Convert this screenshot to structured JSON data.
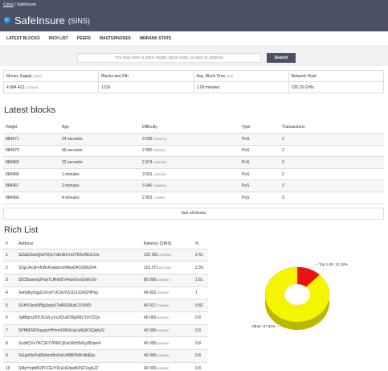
{
  "breadcrumb": {
    "root": "Coins",
    "sep": "/",
    "current": "SafeInsure"
  },
  "brand": {
    "name": "SafeInsure",
    "symbol": "(SINS)"
  },
  "nav": [
    "LATEST BLOCKS",
    "RICH LIST",
    "PEERS",
    "MASTERNODES",
    "MNRANK STATS"
  ],
  "search": {
    "placeholder": "You may enter a block height, block hash, tx hash or address",
    "button": "Search"
  },
  "stats": [
    {
      "label": "Money Supply",
      "label_unit": "(SINS)",
      "value": "4 984 422",
      "value_small": ".41749416"
    },
    {
      "label": "Blocks last 24h",
      "label_unit": "",
      "value": "1316",
      "value_small": ""
    },
    {
      "label": "Avg. Block Time",
      "label_unit": "(24h)",
      "value": "1.09 minutes",
      "value_small": ""
    },
    {
      "label": "Network Hash",
      "label_unit": "",
      "value": "226.29 GH/s",
      "value_small": ""
    }
  ],
  "latest_blocks": {
    "title": "Latest blocks",
    "columns": [
      "Height",
      "Age",
      "Difficulty",
      "Type",
      "Transactions"
    ],
    "rows": [
      {
        "height": "884971",
        "age": "24 seconds",
        "diff": "3 099",
        "diff_small": ".29136716",
        "type": "PoS",
        "tx": "2"
      },
      {
        "height": "884970",
        "age": "46 seconds",
        "diff": "2 950",
        "diff_small": ".82804187",
        "type": "PoS",
        "tx": "2"
      },
      {
        "height": "884969",
        "age": "32 seconds",
        "diff": "2 974",
        "diff_small": ".61637505",
        "type": "PoS",
        "tx": "3"
      },
      {
        "height": "884968",
        "age": "1 minutes",
        "diff": "3 001",
        "diff_small": ".21571932",
        "type": "PoS",
        "tx": "2"
      },
      {
        "height": "884967",
        "age": "2 minutes",
        "diff": "3 040",
        "diff_small": ".05839815",
        "type": "PoS",
        "tx": "2"
      },
      {
        "height": "884966",
        "age": "4 minutes",
        "diff": "2 953",
        "diff_small": ".7429959",
        "type": "PoS",
        "tx": "3"
      }
    ],
    "see_all": "See all blocks"
  },
  "rich_list": {
    "title": "Rich List",
    "columns": [
      "#",
      "Address",
      "Balance (SINS)",
      "%"
    ],
    "rows": [
      {
        "n": "1",
        "addr": "SZtqD3ozQjtzF0QcTxEnB1Vn27D6cREcLVw",
        "bal": "120 001",
        "bal_small": ".70000000",
        "pct": "2.41"
      },
      {
        "n": "2",
        "addr": "SSg1AcqFnfnBuFpqkierzNhkaDASSRbZFA",
        "bal": "116 371",
        "bal_small": ".80072896",
        "pct": "2.33"
      },
      {
        "n": "3",
        "addr": "SfC5banmjUPueTURnkDV4xbrGvsDmKXXr",
        "bal": "80 000",
        "bal_small": ".00000000",
        "pct": "1.61"
      },
      {
        "n": "4",
        "addr": "Sefq9ky5qgZsVcwTUCshYZUG1S3nQHPbg",
        "bal": "49 822",
        "bal_small": ".00000000",
        "pct": "1"
      },
      {
        "n": "5",
        "addr": "SXHX3erk5fBg3sbyXToR6936ztCXXhfZt",
        "bal": "40 917",
        "bal_small": ".27000000",
        "pct": "0.82"
      },
      {
        "n": "6",
        "addr": "Sj4BqmZKfUSSzLyVx2fZuW36pR8U7m7ZQo",
        "bal": "40 000",
        "bal_small": ".00000000",
        "pct": "0.8"
      },
      {
        "n": "7",
        "addr": "SPHMSRDquypzHHrmXMUtUujUybQKSQqKyG",
        "bal": "40 000",
        "bal_small": ".00000000",
        "pct": "0.8"
      },
      {
        "n": "8",
        "addr": "ScddQVv7NC3FY2NWCjKwSRH9xFjyBDqm4",
        "bal": "40 000",
        "bal_small": ".00000000",
        "pct": "0.8"
      },
      {
        "n": "9",
        "addr": "SiEpz6InPy8RAmzBcKieU4BBPb9Fdk8Ejv",
        "bal": "40 000",
        "bal_small": ".00000000",
        "pct": "0.8"
      },
      {
        "n": "10",
        "addr": "SMpYrqfd8UPCCErYDuUA2pe8t2NZ1cg6JZ",
        "bal": "40 000",
        "bal_small": ".00000000",
        "pct": "0.8"
      }
    ]
  },
  "chart_data": {
    "type": "pie",
    "slices": [
      {
        "label": "Top 1-25: 12.18%",
        "value": 12.18,
        "color": "#ee1111"
      },
      {
        "label": "Other: 87.82%",
        "value": 87.82,
        "color": "#f5f500"
      }
    ]
  },
  "colors": {
    "topbar": "#4a5164",
    "accent": "#4a5164"
  }
}
